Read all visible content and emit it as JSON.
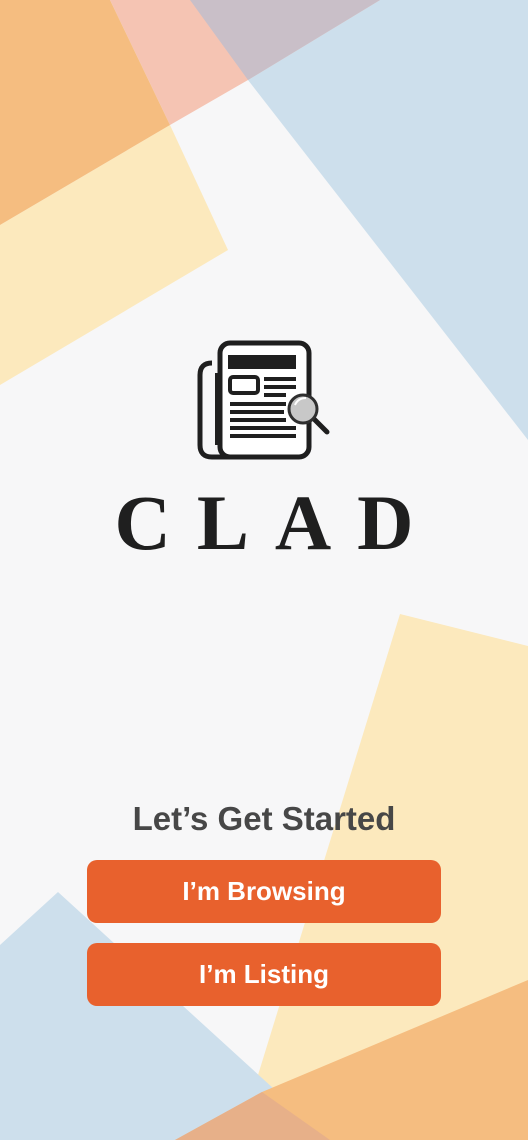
{
  "app": {
    "brand_name": "CLAD",
    "logo_icon": "newspaper-search-icon"
  },
  "welcome": {
    "heading": "Let’s Get Started",
    "buttons": [
      {
        "id": "browsing",
        "label": "I’m Browsing"
      },
      {
        "id": "listing",
        "label": "I’m Listing"
      }
    ]
  },
  "colors": {
    "accent": "#e8612d",
    "background": "#f7f7f8",
    "shape_orange": "#f5bd80",
    "shape_yellow": "#fce9bd",
    "shape_blue": "#cddfec",
    "shape_pink": "#f5c4b3",
    "text_dark": "#1f1f1f",
    "text_heading": "#474747"
  }
}
